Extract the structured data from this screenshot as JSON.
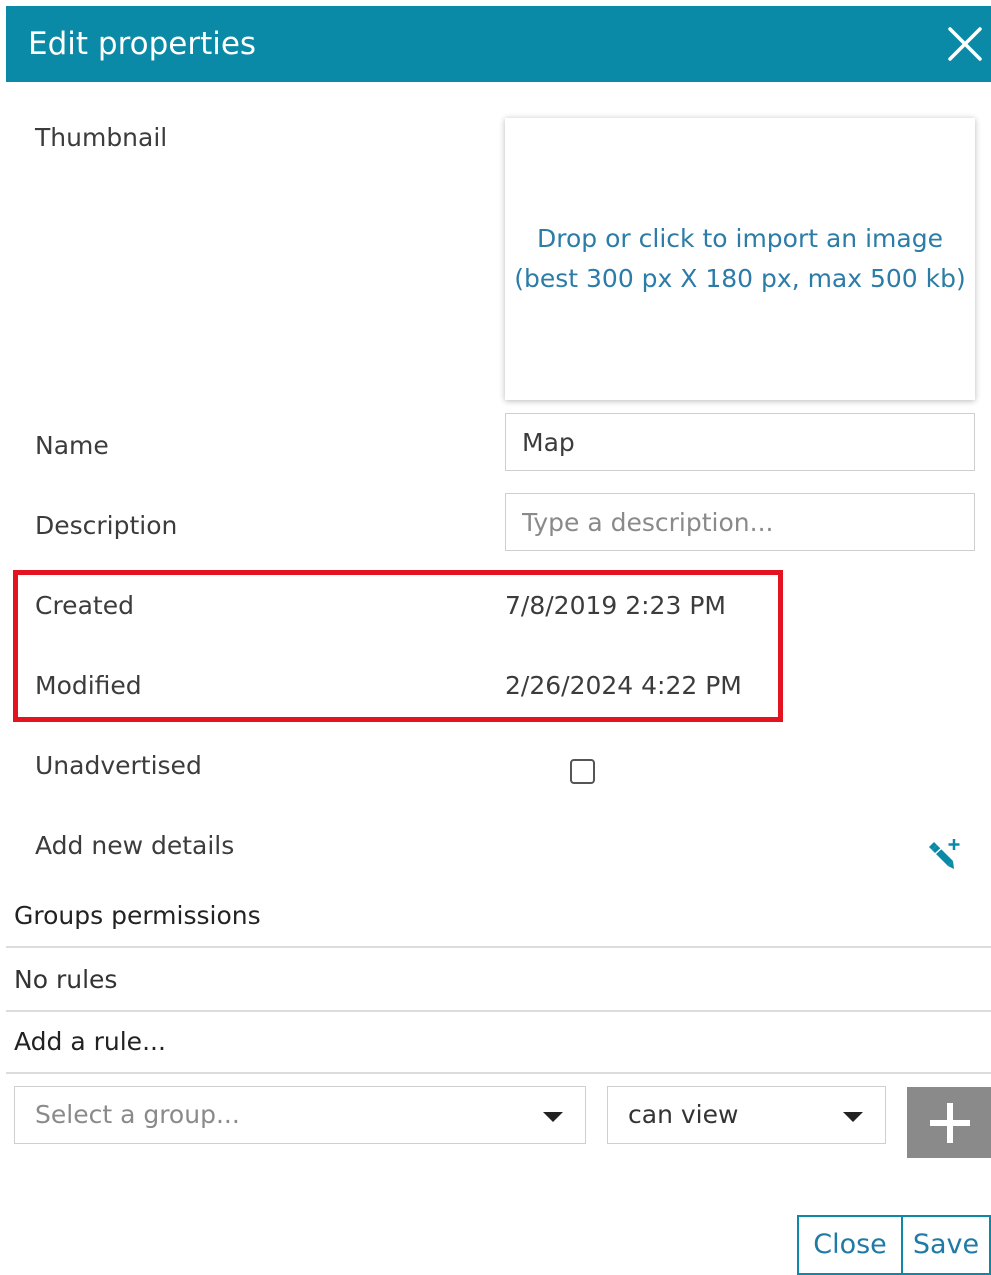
{
  "dialog": {
    "title": "Edit properties",
    "header_color": "#0a8aa6"
  },
  "fields": {
    "thumbnail_label": "Thumbnail",
    "dropzone_line1": "Drop or click to import an image",
    "dropzone_line2": "(best 300 px X 180 px, max 500 kb)",
    "name_label": "Name",
    "name_value": "Map",
    "description_label": "Description",
    "description_placeholder": "Type a description...",
    "created_label": "Created",
    "created_value": "7/8/2019 2:23 PM",
    "modified_label": "Modified",
    "modified_value": "2/26/2024 4:22 PM",
    "unadvertised_label": "Unadvertised",
    "add_details_label": "Add new details",
    "add_details_icon": "pen-plus-icon"
  },
  "permissions": {
    "title": "Groups permissions",
    "empty_text": "No rules",
    "add_rule_title": "Add a rule...",
    "group_select_placeholder": "Select a group...",
    "permission_select_value": "can view",
    "add_icon": "plus-icon"
  },
  "footer": {
    "close_label": "Close",
    "save_label": "Save"
  },
  "highlight_color": "#e3141f"
}
